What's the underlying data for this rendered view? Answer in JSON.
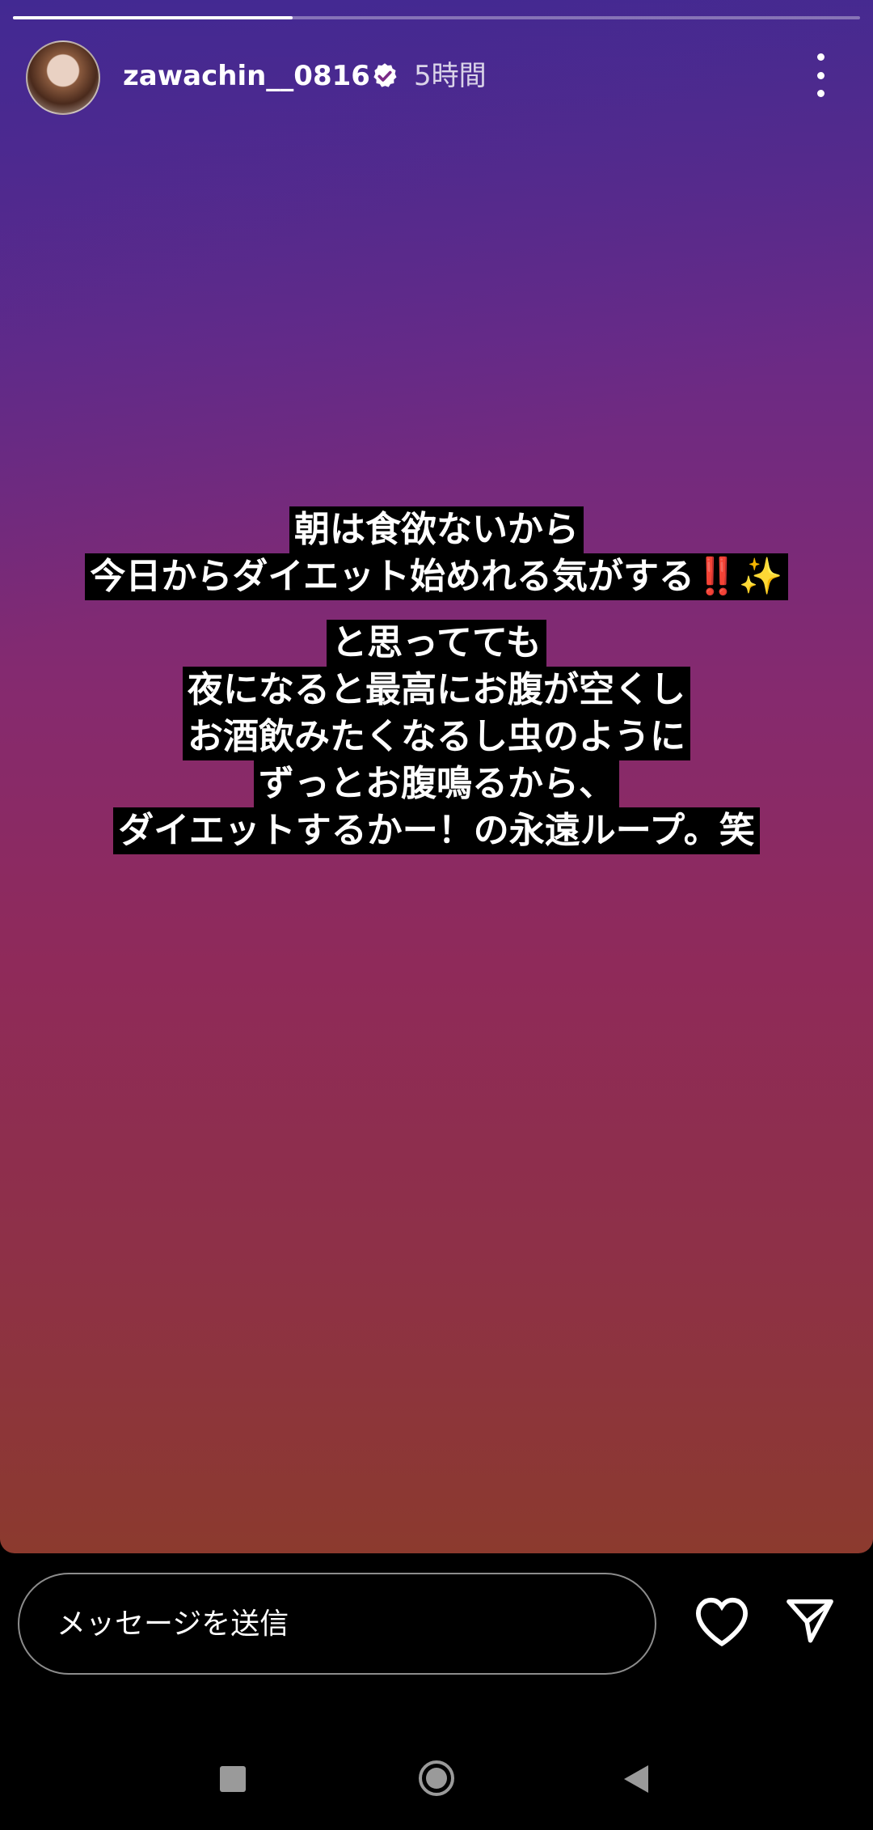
{
  "story": {
    "progress": 0.33,
    "user": {
      "username": "zawachin__0816",
      "verified": true,
      "time": "5時間"
    },
    "caption": {
      "lines": [
        "朝は食欲ないから",
        "今日からダイエット始めれる気がする‼️✨",
        "と思ってても",
        "夜になると最高にお腹が空くし",
        "お酒飲みたくなるし虫のように",
        "ずっとお腹鳴るから、",
        "ダイエットするかー！の永遠ループ。笑"
      ]
    }
  },
  "reply": {
    "placeholder": "メッセージを送信"
  },
  "icons": {
    "verified": "verified-badge-icon",
    "menu": "more-options-icon",
    "like": "heart-icon",
    "share": "send-icon"
  },
  "colors": {
    "badge": "#ffffff"
  },
  "system_nav": {
    "items": [
      "recents",
      "home",
      "back"
    ]
  }
}
